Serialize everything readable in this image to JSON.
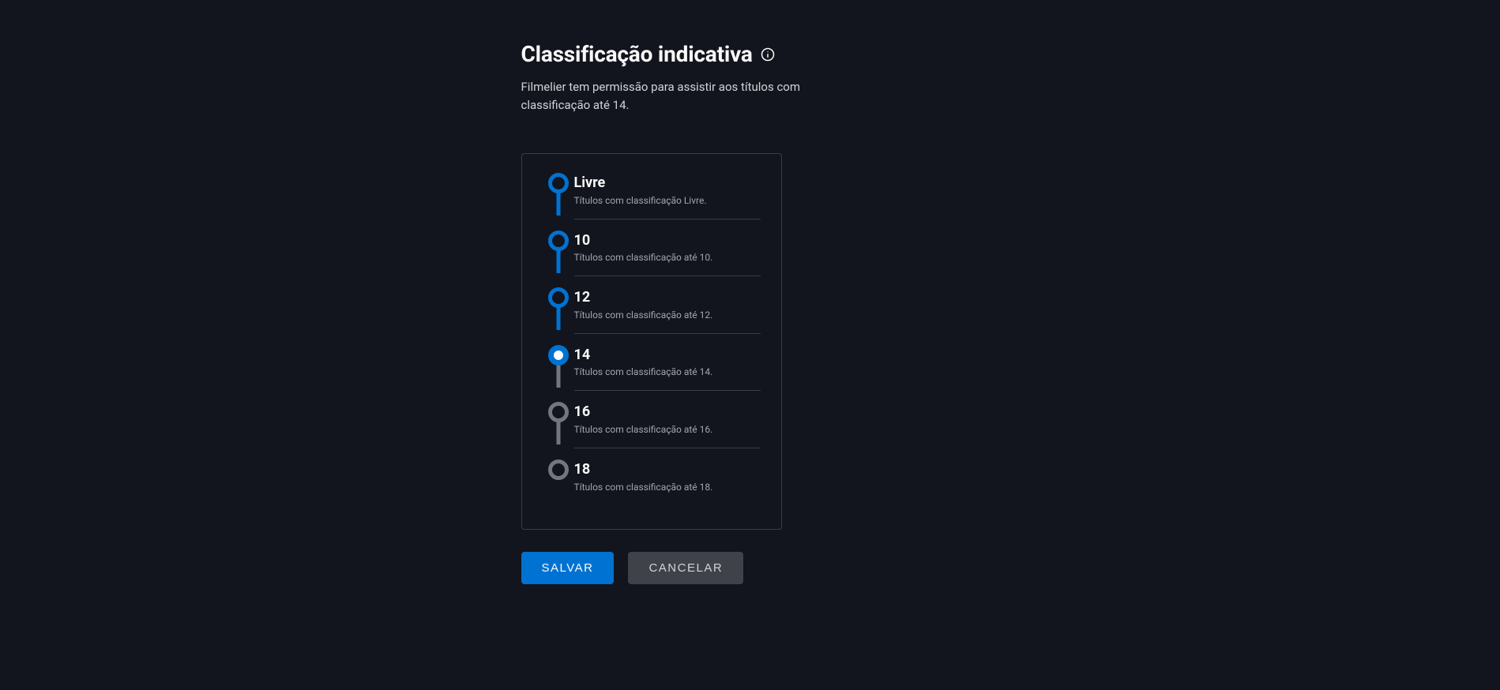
{
  "header": {
    "title": "Classificação indicativa",
    "subtitle": "Filmelier tem permissão para assistir aos títulos com classificação até 14."
  },
  "ratings": [
    {
      "label": "Livre",
      "desc": "Títulos com classificação Livre.",
      "state": "active"
    },
    {
      "label": "10",
      "desc": "Títulos com classificação até 10.",
      "state": "active"
    },
    {
      "label": "12",
      "desc": "Títulos com classificação até 12.",
      "state": "active"
    },
    {
      "label": "14",
      "desc": "Títulos com classificação até 14.",
      "state": "selected"
    },
    {
      "label": "16",
      "desc": "Títulos com classificação até 16.",
      "state": "inactive"
    },
    {
      "label": "18",
      "desc": "Títulos com classificação até 18.",
      "state": "inactive"
    }
  ],
  "buttons": {
    "save": "Salvar",
    "cancel": "Cancelar"
  }
}
